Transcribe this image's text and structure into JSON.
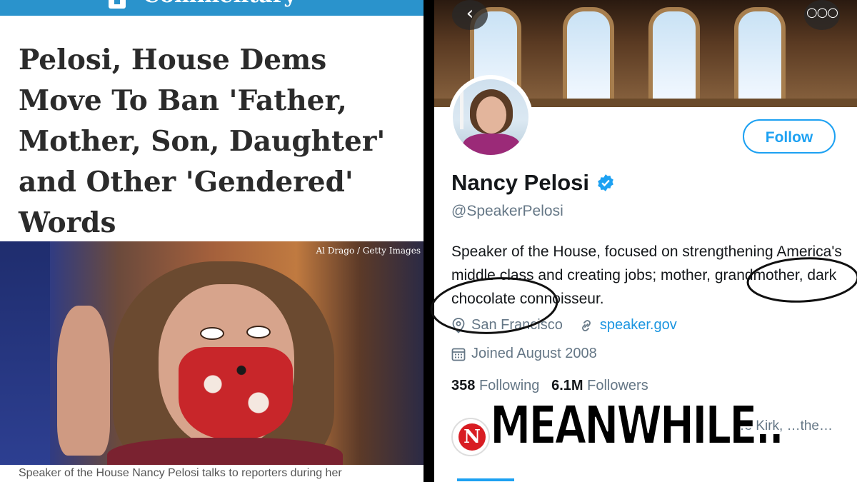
{
  "article": {
    "section_label": "Commentary",
    "headline": "Pelosi, House Dems Move To Ban 'Father, Mother, Son, Daughter' and Other 'Gendered' Words",
    "photo_credit": "Al Drago / Getty Images",
    "caption": "Speaker of the House Nancy Pelosi talks to reporters during her"
  },
  "profile": {
    "display_name": "Nancy Pelosi",
    "handle": "@SpeakerPelosi",
    "follow_label": "Follow",
    "bio": "Speaker of the House, focused on strengthening America's middle class and creating jobs; mother, grandmother, dark chocolate connoisseur.",
    "location": "San Francisco",
    "website": "speaker.gov",
    "joined": "Joined August 2008",
    "following_count": "358",
    "following_label": "Following",
    "followers_count": "6.1M",
    "followers_label": "Followers",
    "followed_by_partial": "…e Kirk, …the…",
    "accent_color": "#1da1f2"
  },
  "meme": {
    "overlay_text": "MEANWHILE.."
  },
  "icons": {
    "back": "chevron-left-icon",
    "more": "more-options-icon",
    "verified": "verified-badge-icon",
    "location": "location-pin-icon",
    "link": "link-icon",
    "calendar": "calendar-icon"
  }
}
